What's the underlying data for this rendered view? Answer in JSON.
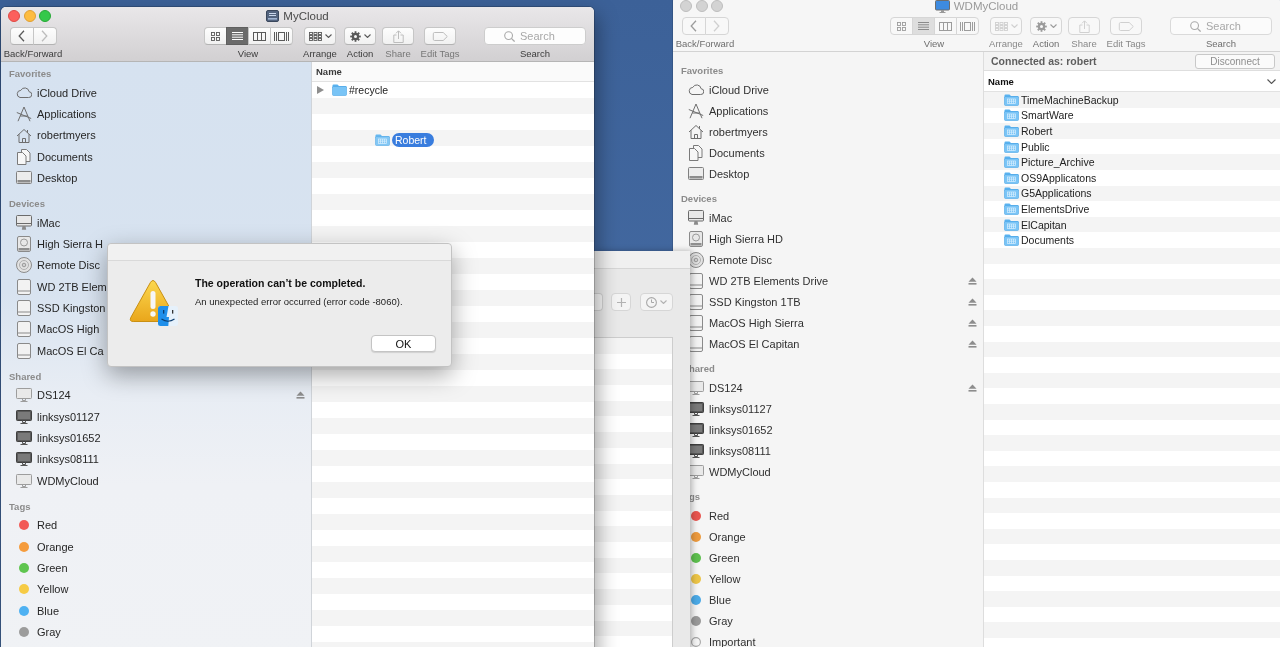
{
  "windows": [
    {
      "kind": "share",
      "active": true,
      "title": "MyCloud",
      "toolbar": {
        "back_forward": {
          "label": "Back/Forward",
          "back_disabled": false,
          "forward_disabled": true
        },
        "view": {
          "label": "View",
          "modes": [
            {
              "selected": false
            },
            {
              "selected": true
            },
            {
              "selected": false
            },
            {
              "selected": false
            }
          ]
        },
        "buttons": [
          {
            "kind": "arrange",
            "label": "Arrange",
            "disabled": false
          },
          {
            "kind": "action",
            "label": "Action",
            "disabled": false
          },
          {
            "kind": "share",
            "label": "Share",
            "disabled": true
          },
          {
            "kind": "tags",
            "label": "Edit Tags",
            "disabled": true
          }
        ],
        "search": {
          "placeholder": "Search",
          "label": "Search"
        }
      },
      "sidebar": [
        {
          "heading": "Favorites",
          "items": [
            {
              "kind": "cloud",
              "label": "iCloud Drive",
              "ejectable": false
            },
            {
              "kind": "applications",
              "label": "Applications",
              "ejectable": false
            },
            {
              "kind": "home",
              "label": "robertmyers",
              "ejectable": false
            },
            {
              "kind": "documents",
              "label": "Documents",
              "ejectable": false
            },
            {
              "kind": "desktop",
              "label": "Desktop",
              "ejectable": false
            }
          ]
        },
        {
          "heading": "Devices",
          "items": [
            {
              "kind": "computer",
              "label": "iMac",
              "ejectable": false
            },
            {
              "kind": "disk",
              "label": "High Sierra H",
              "ejectable": false
            },
            {
              "kind": "disc",
              "label": "Remote Disc",
              "ejectable": false
            },
            {
              "kind": "drive",
              "label": "WD 2TB Elem",
              "ejectable": false
            },
            {
              "kind": "drive",
              "label": "SSD Kingston",
              "ejectable": false
            },
            {
              "kind": "drive",
              "label": "MacOS High",
              "ejectable": false
            },
            {
              "kind": "drive",
              "label": "MacOS El Ca",
              "ejectable": false
            }
          ]
        },
        {
          "heading": "Shared",
          "items": [
            {
              "kind": "server",
              "label": "DS124",
              "ejectable": true
            },
            {
              "kind": "pc",
              "label": "linksys01127",
              "ejectable": false
            },
            {
              "kind": "pc",
              "label": "linksys01652",
              "ejectable": false
            },
            {
              "kind": "pc",
              "label": "linksys08111",
              "ejectable": false
            },
            {
              "kind": "server",
              "label": "WDMyCloud",
              "ejectable": false
            }
          ]
        },
        {
          "heading": "Tags",
          "items": [
            {
              "kind": "tag",
              "label": "Red",
              "color": "#f25a56",
              "ejectable": false
            },
            {
              "kind": "tag",
              "label": "Orange",
              "color": "#f59c3d",
              "ejectable": false
            },
            {
              "kind": "tag",
              "label": "Green",
              "color": "#5fc54f",
              "ejectable": false
            },
            {
              "kind": "tag",
              "label": "Yellow",
              "color": "#f6cb45",
              "ejectable": false
            },
            {
              "kind": "tag",
              "label": "Blue",
              "color": "#4eb1f2",
              "ejectable": false
            },
            {
              "kind": "tag",
              "label": "Gray",
              "color": "#9c9c9c",
              "ejectable": false
            }
          ]
        }
      ],
      "list": {
        "column": "Name",
        "sorted": false,
        "rows": [
          {
            "kind": "folder",
            "name": "#recycle",
            "expandable": true
          }
        ],
        "drag_item": {
          "kind": "share",
          "label": "Robert"
        }
      }
    },
    {
      "kind": "server",
      "active": false,
      "title": "WDMyCloud",
      "toolbar": {
        "back_forward": {
          "label": "Back/Forward",
          "back_disabled": false,
          "forward_disabled": true
        },
        "view": {
          "label": "View",
          "modes": [
            {
              "selected": false
            },
            {
              "selected": true
            },
            {
              "selected": false
            },
            {
              "selected": false
            }
          ]
        },
        "buttons": [
          {
            "kind": "arrange",
            "label": "Arrange",
            "disabled": true
          },
          {
            "kind": "action",
            "label": "Action",
            "disabled": false
          },
          {
            "kind": "share",
            "label": "Share",
            "disabled": true
          },
          {
            "kind": "tags",
            "label": "Edit Tags",
            "disabled": true
          }
        ],
        "search": {
          "placeholder": "Search",
          "label": "Search"
        }
      },
      "sidebar": [
        {
          "heading": "Favorites",
          "items": [
            {
              "kind": "cloud",
              "label": "iCloud Drive",
              "ejectable": false
            },
            {
              "kind": "applications",
              "label": "Applications",
              "ejectable": false
            },
            {
              "kind": "home",
              "label": "robertmyers",
              "ejectable": false
            },
            {
              "kind": "documents",
              "label": "Documents",
              "ejectable": false
            },
            {
              "kind": "desktop",
              "label": "Desktop",
              "ejectable": false
            }
          ]
        },
        {
          "heading": "Devices",
          "items": [
            {
              "kind": "computer",
              "label": "iMac",
              "ejectable": false
            },
            {
              "kind": "disk",
              "label": "High Sierra HD",
              "ejectable": false
            },
            {
              "kind": "disc",
              "label": "Remote Disc",
              "ejectable": false
            },
            {
              "kind": "drive",
              "label": "WD 2TB Elements Drive",
              "ejectable": true
            },
            {
              "kind": "drive",
              "label": "SSD Kingston 1TB",
              "ejectable": true
            },
            {
              "kind": "drive",
              "label": "MacOS High Sierra",
              "ejectable": true
            },
            {
              "kind": "drive",
              "label": "MacOS El Capitan",
              "ejectable": true
            }
          ]
        },
        {
          "heading": "hared",
          "items": [
            {
              "kind": "server",
              "label": "DS124",
              "ejectable": true
            },
            {
              "kind": "pc",
              "label": "linksys01127",
              "ejectable": false
            },
            {
              "kind": "pc",
              "label": "linksys01652",
              "ejectable": false
            },
            {
              "kind": "pc",
              "label": "linksys08111",
              "ejectable": false
            },
            {
              "kind": "server",
              "label": "WDMyCloud",
              "ejectable": false
            }
          ]
        },
        {
          "heading": "gs",
          "items": [
            {
              "kind": "tag",
              "label": "Red",
              "color": "#e8554f",
              "ejectable": false
            },
            {
              "kind": "tag",
              "label": "Orange",
              "color": "#ec9a3e",
              "ejectable": false
            },
            {
              "kind": "tag",
              "label": "Green",
              "color": "#5dbf4e",
              "ejectable": false
            },
            {
              "kind": "tag",
              "label": "Yellow",
              "color": "#ecc447",
              "ejectable": false
            },
            {
              "kind": "tag",
              "label": "Blue",
              "color": "#4aa9e6",
              "ejectable": false
            },
            {
              "kind": "tag",
              "label": "Gray",
              "color": "#999999",
              "ejectable": false
            },
            {
              "kind": "tag",
              "label": "Important",
              "ejectable": false
            }
          ]
        }
      ],
      "connection": {
        "text": "Connected as: robert",
        "button": "Disconnect"
      },
      "list": {
        "column": "Name",
        "sorted": true,
        "rows": [
          {
            "kind": "share",
            "name": "TimeMachineBackup",
            "expandable": false
          },
          {
            "kind": "share",
            "name": "SmartWare",
            "expandable": false
          },
          {
            "kind": "share",
            "name": "Robert",
            "expandable": false
          },
          {
            "kind": "share",
            "name": "Public",
            "expandable": false
          },
          {
            "kind": "share",
            "name": "Picture_Archive",
            "expandable": false
          },
          {
            "kind": "share",
            "name": "OS9Applicatons",
            "expandable": false
          },
          {
            "kind": "share",
            "name": "G5Applications",
            "expandable": false
          },
          {
            "kind": "share",
            "name": "ElementsDrive",
            "expandable": false
          },
          {
            "kind": "share",
            "name": "ElCapitan",
            "expandable": false
          },
          {
            "kind": "share",
            "name": "Documents",
            "expandable": false
          }
        ]
      }
    }
  ],
  "alert": {
    "title": "The operation can’t be completed.",
    "message": "An unexpected error occurred (error code -8060).",
    "buttons": [
      "OK"
    ]
  }
}
